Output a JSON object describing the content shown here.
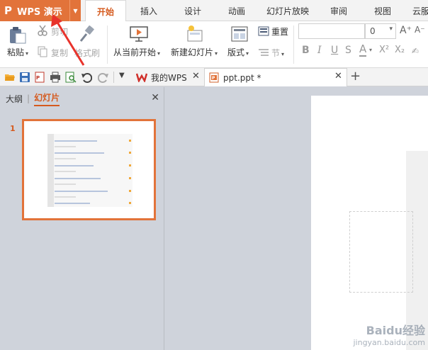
{
  "app": {
    "name": "WPS 演示",
    "logo": "P"
  },
  "menu_tabs": [
    "开始",
    "插入",
    "设计",
    "动画",
    "幻灯片放映",
    "审阅",
    "视图",
    "云服"
  ],
  "active_menu_tab": "开始",
  "ribbon": {
    "paste": "粘贴",
    "cut": "剪切",
    "copy": "复制",
    "format_painter": "格式刷",
    "from_current": "从当前开始",
    "new_slide": "新建幻灯片",
    "layout": "版式",
    "reset": "重置",
    "section": "节",
    "font_name": "",
    "font_size": "0"
  },
  "format_buttons": [
    "B",
    "I",
    "U",
    "S",
    "A",
    "X²",
    "X₂"
  ],
  "doc_tabs": [
    {
      "label": "我的WPS",
      "active": false
    },
    {
      "label": "ppt.ppt *",
      "active": true
    }
  ],
  "panel": {
    "outline_tab": "大纲",
    "slides_tab": "幻灯片",
    "slide_number": "1"
  },
  "watermark": {
    "line1": "Baidu经验",
    "line2": "jingyan.baidu.com"
  },
  "colors": {
    "accent": "#e2733a",
    "active_text": "#d55a1e",
    "arrow": "#e8332b"
  }
}
